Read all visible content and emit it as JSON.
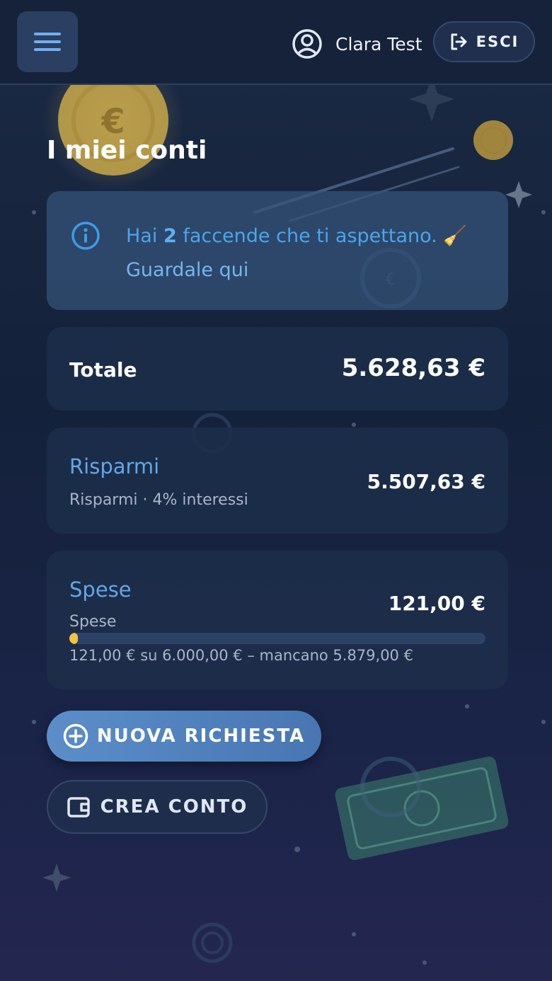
{
  "header": {
    "menu_icon": "hamburger-menu-icon",
    "user_icon": "user-circle-icon",
    "user_name": "Clara Test",
    "logout_icon": "logout-icon",
    "logout_label": "ESCI"
  },
  "page": {
    "title": "I miei conti"
  },
  "info": {
    "icon": "info-icon",
    "text_before": "Hai ",
    "count": "2",
    "text_after": " faccende che ti aspettano. 🧹",
    "link": "Guardale qui"
  },
  "total": {
    "label": "Totale",
    "value": "5.628,63 €"
  },
  "accounts": [
    {
      "name": "Risparmi",
      "subtitle": "Risparmi · 4% interessi",
      "amount": "5.507,63 €"
    },
    {
      "name": "Spese",
      "subtitle": "Spese",
      "amount": "121,00 €",
      "progress_fraction": 0.02,
      "progress_text": "121,00 € su 6.000,00 € – mancano 5.879,00 €"
    }
  ],
  "buttons": {
    "new_request_icon": "plus-circle-icon",
    "new_request_label": "NUOVA RICHIESTA",
    "create_account_icon": "wallet-icon",
    "create_account_label": "CREA CONTO"
  },
  "colors": {
    "accent": "#4ea4ec",
    "progress": "#f2c444",
    "primary_button": "#5b8ec9"
  }
}
